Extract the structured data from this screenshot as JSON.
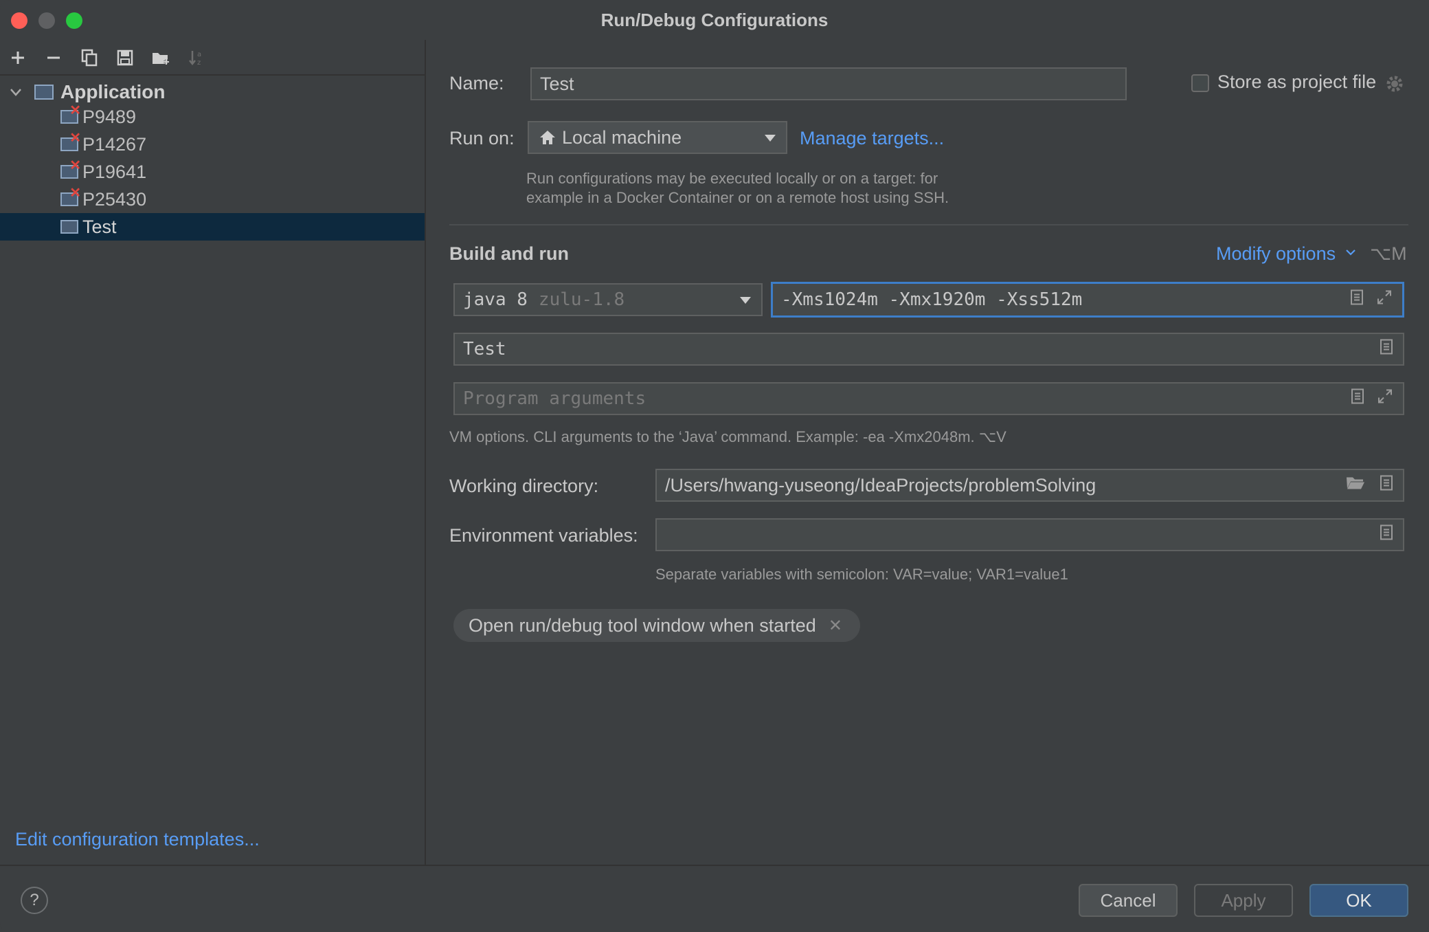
{
  "window": {
    "title": "Run/Debug Configurations"
  },
  "toolbar": {
    "icons": [
      "plus-icon",
      "minus-icon",
      "copy-icon",
      "save-icon",
      "new-folder-icon",
      "sort-icon"
    ]
  },
  "tree": {
    "root_label": "Application",
    "items": [
      {
        "label": "P9489",
        "error": true
      },
      {
        "label": "P14267",
        "error": true
      },
      {
        "label": "P19641",
        "error": true
      },
      {
        "label": "P25430",
        "error": true
      },
      {
        "label": "Test",
        "error": false,
        "selected": true
      }
    ]
  },
  "left_footer": {
    "edit_templates_link": "Edit configuration templates..."
  },
  "form": {
    "name_label": "Name:",
    "name_value": "Test",
    "store_project_label": "Store as project file",
    "run_on_label": "Run on:",
    "run_on_value": "Local machine",
    "manage_targets_link": "Manage targets...",
    "run_on_hint_line1": "Run configurations may be executed locally or on a target: for",
    "run_on_hint_line2": "example in a Docker Container or on a remote host using SSH.",
    "section_title": "Build and run",
    "modify_options_link": "Modify options",
    "modify_options_shortcut": "⌥M",
    "jdk_value": "java 8",
    "jdk_detail": "zulu-1.8",
    "vm_options_value": "-Xms1024m -Xmx1920m -Xss512m",
    "main_class_value": "Test",
    "program_args_placeholder": "Program arguments",
    "vm_hint": "VM options. CLI arguments to the ‘Java’ command. Example: -ea -Xmx2048m. ⌥V",
    "working_dir_label": "Working directory:",
    "working_dir_value": "/Users/hwang-yuseong/IdeaProjects/problemSolving",
    "env_vars_label": "Environment variables:",
    "env_vars_value": "",
    "env_hint": "Separate variables with semicolon: VAR=value; VAR1=value1",
    "tag_label": "Open run/debug tool window when started"
  },
  "buttons": {
    "cancel": "Cancel",
    "apply": "Apply",
    "ok": "OK",
    "help": "?"
  },
  "colors": {
    "background": "#3c3f41",
    "link": "#589df6",
    "selection": "#0d293e",
    "focus": "#3d7ec9",
    "ok_button": "#365880",
    "error": "#e0463f"
  }
}
